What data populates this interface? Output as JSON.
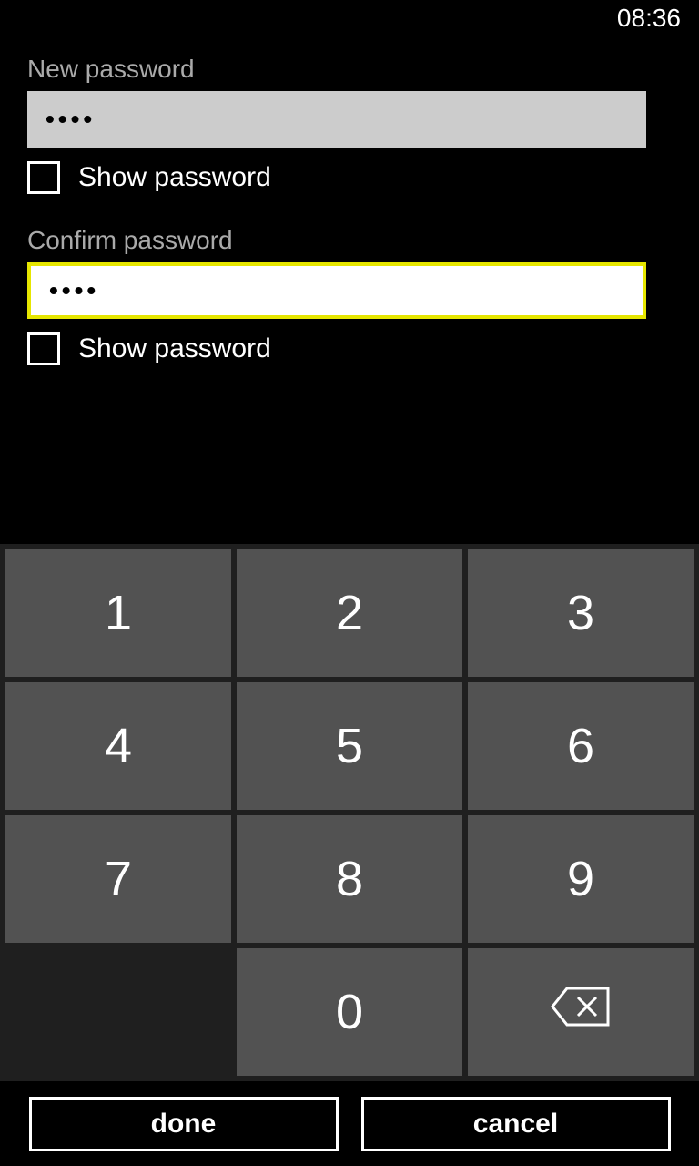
{
  "status_bar": {
    "time": "08:36"
  },
  "form": {
    "new_password": {
      "label": "New password",
      "value": "••••",
      "show_label": "Show password"
    },
    "confirm_password": {
      "label": "Confirm password",
      "value": "••••",
      "show_label": "Show password"
    }
  },
  "keypad": {
    "keys": [
      "1",
      "2",
      "3",
      "4",
      "5",
      "6",
      "7",
      "8",
      "9",
      "0"
    ]
  },
  "app_bar": {
    "done_label": "done",
    "cancel_label": "cancel"
  }
}
